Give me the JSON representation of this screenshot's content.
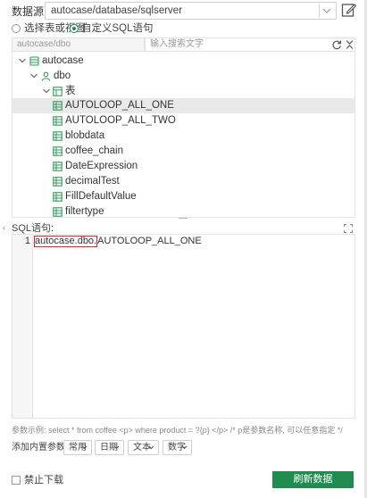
{
  "datasource": {
    "label": "数据源:",
    "value": "autocase/database/sqlserver"
  },
  "mode": {
    "table_option": "选择表或视图",
    "sql_option": "自定义SQL语句",
    "selected": "sql"
  },
  "schema": {
    "placeholder": "autocase/dbo"
  },
  "search": {
    "placeholder": "输入搜索文字"
  },
  "tree": {
    "nodes": [
      {
        "label": "autocase",
        "type": "database",
        "expanded": true
      },
      {
        "label": "dbo",
        "type": "schema",
        "expanded": true
      },
      {
        "label": "表",
        "type": "folder",
        "expanded": true
      },
      {
        "label": "AUTOLOOP_ALL_ONE",
        "type": "table",
        "selected": true
      },
      {
        "label": "AUTOLOOP_ALL_TWO",
        "type": "table"
      },
      {
        "label": "blobdata",
        "type": "table"
      },
      {
        "label": "coffee_chain",
        "type": "table"
      },
      {
        "label": "DateExpression",
        "type": "table"
      },
      {
        "label": "decimalTest",
        "type": "table"
      },
      {
        "label": "FillDefaultValue",
        "type": "table"
      },
      {
        "label": "filtertype",
        "type": "table"
      }
    ]
  },
  "sql": {
    "label": "SQL语句:",
    "line_number": "1",
    "highlighted_text": "autocase.dbo.",
    "rest_text": "AUTOLOOP_ALL_ONE"
  },
  "hints": {
    "param_example": "参数示例: select * from coffee <p> where product = ?{p} </p> /* p是参数名称, 可以任意指定 */",
    "builtin_label": "添加内置参数:",
    "builtin_params": [
      "常用",
      "日期",
      "文本",
      "数字"
    ]
  },
  "footer": {
    "forbid_download_label": "禁止下载",
    "refresh_button_label": "刷新数据"
  },
  "colors": {
    "accent": "#1e8c4e",
    "highlight_border": "#d9252b",
    "selected_row": "#e9e9e9",
    "icon_green": "#2f9b57"
  },
  "icons": {
    "edit": "edit-icon",
    "refresh": "refresh-icon",
    "collapse_all": "collapse-all-icon",
    "fullscreen": "fullscreen-icon",
    "database": "database-icon",
    "schema": "user-icon",
    "folder": "table-folder-icon",
    "table": "table-icon"
  }
}
